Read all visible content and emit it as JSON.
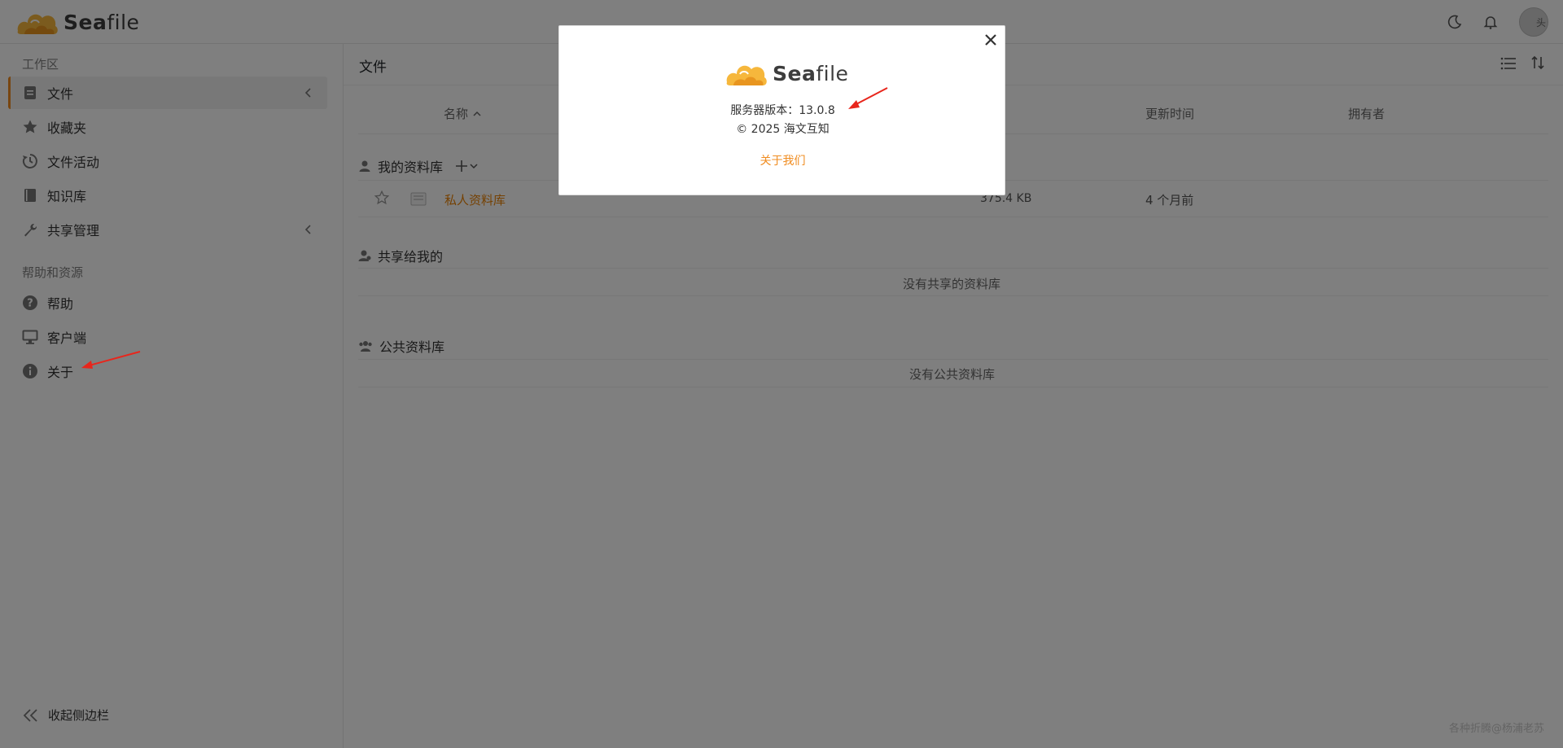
{
  "header": {
    "logo_text_bold": "Sea",
    "logo_text_rest": "file",
    "avatar_alt": "头"
  },
  "sidebar": {
    "workspace_heading": "工作区",
    "items": [
      {
        "label": "文件"
      },
      {
        "label": "收藏夹"
      },
      {
        "label": "文件活动"
      },
      {
        "label": "知识库"
      },
      {
        "label": "共享管理"
      }
    ],
    "help_heading": "帮助和资源",
    "help_items": [
      {
        "label": "帮助"
      },
      {
        "label": "客户端"
      },
      {
        "label": "关于"
      }
    ],
    "collapse_label": "收起侧边栏"
  },
  "main": {
    "title": "文件",
    "columns": {
      "name": "名称",
      "updated": "更新时间",
      "owner": "拥有者"
    },
    "my_libraries": {
      "title": "我的资料库",
      "rows": [
        {
          "name": "私人资料库",
          "size": "375.4 KB",
          "updated": "4 个月前"
        }
      ]
    },
    "shared_with_me": {
      "title": "共享给我的",
      "empty": "没有共享的资料库"
    },
    "public_libraries": {
      "title": "公共资料库",
      "empty": "没有公共资料库"
    }
  },
  "modal": {
    "logo_text_bold": "Sea",
    "logo_text_rest": "file",
    "version_text": "服务器版本：13.0.8",
    "copyright_text": "© 2025 海文互知",
    "about_link": "关于我们"
  },
  "watermark": "各种折腾@杨浦老苏",
  "colors": {
    "accent": "#f08c20",
    "overlay": "rgba(0,0,0,0.5)"
  }
}
